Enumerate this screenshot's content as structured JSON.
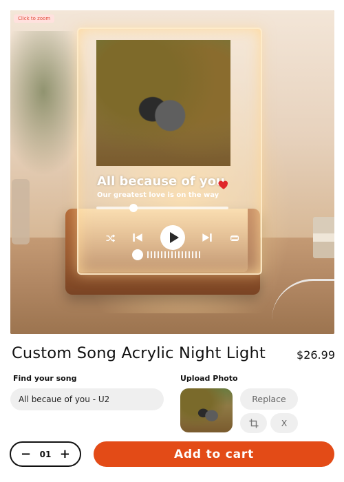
{
  "hero": {
    "zoom_label": "Click to zoom",
    "preview": {
      "song_title": "All because of you",
      "song_subtitle": "Our greatest love is on the way",
      "progress": 0.28,
      "accent_heart": "#e0262a"
    }
  },
  "product": {
    "title": "Custom Song Acrylic Night Light",
    "price": "$26.99"
  },
  "song_field": {
    "label": "Find your song",
    "value": "All becaue of you - U2"
  },
  "photo_upload": {
    "label": "Upload Photo",
    "replace_label": "Replace",
    "crop_icon": "crop-icon",
    "remove_label": "X"
  },
  "quantity": {
    "decrement": "−",
    "value": "01",
    "increment": "+"
  },
  "cart": {
    "label": "Add to cart",
    "color": "#e34b17"
  }
}
